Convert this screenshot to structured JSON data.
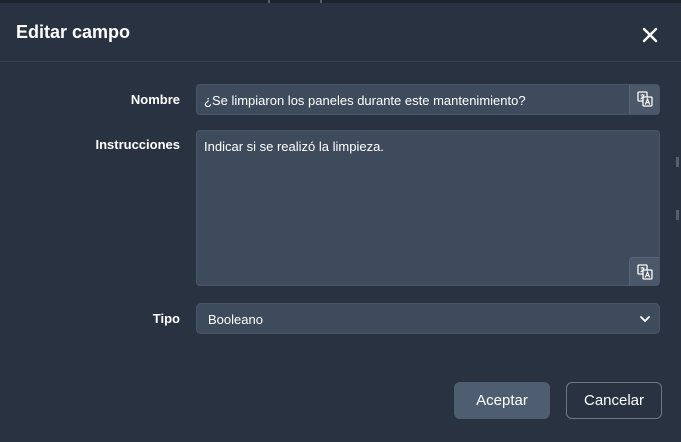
{
  "dialog": {
    "title": "Editar campo",
    "close_icon": "close-icon"
  },
  "form": {
    "name_label": "Nombre",
    "name_value": "¿Se limpiaron los paneles durante este mantenimiento?",
    "instructions_label": "Instrucciones",
    "instructions_value": "Indicar si se realizó la limpieza.",
    "type_label": "Tipo",
    "type_value": "Booleano",
    "translate_icon": "translate-icon"
  },
  "actions": {
    "accept_label": "Aceptar",
    "cancel_label": "Cancelar"
  },
  "colors": {
    "background": "#283240",
    "input_bg": "#3e4b5c",
    "primary_button": "#4e5d6f",
    "text": "#ffffff"
  }
}
